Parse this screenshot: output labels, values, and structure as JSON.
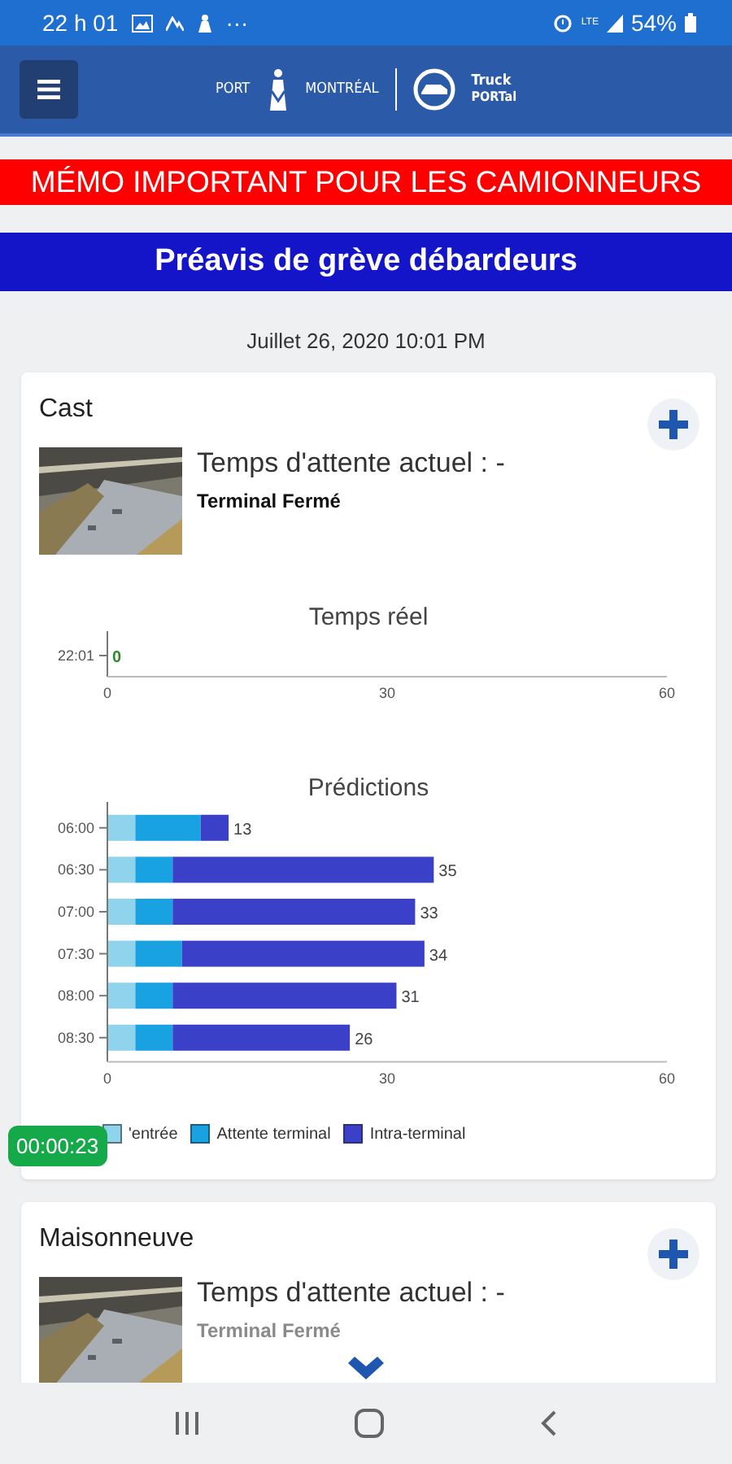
{
  "status_bar": {
    "time": "22 h 01",
    "notification_more": "···",
    "network": "LTE",
    "battery": "54%"
  },
  "header": {
    "logo_left": "PORT",
    "logo_right": "MONTRÉAL",
    "app_name_1": "Truck",
    "app_name_2": "PORTal"
  },
  "memo_banner": "MÉMO IMPORTANT POUR LES CAMIONNEURS",
  "notice_banner": "Préavis de grève débardeurs",
  "date": "Juillet 26, 2020 10:01 PM",
  "terminals": [
    {
      "name": "Cast",
      "wait_label": "Temps d'attente actuel : -",
      "status": "Terminal Fermé",
      "realtime_title": "Temps réel",
      "realtime_chart": {
        "chart_data": {
          "type": "bar",
          "orientation": "horizontal",
          "categories": [
            "22:01"
          ],
          "series": [
            {
              "color": "#2e8b2e",
              "values": [
                0
              ]
            }
          ],
          "xlim": [
            0,
            60
          ],
          "xticks": [
            0,
            30,
            60
          ],
          "value_labels": [
            "0"
          ]
        }
      },
      "predictions_title": "Prédictions",
      "predictions_chart": {
        "chart_data": {
          "type": "bar",
          "orientation": "horizontal",
          "stacked": true,
          "categories": [
            "06:00",
            "06:30",
            "07:00",
            "07:30",
            "08:00",
            "08:30"
          ],
          "series": [
            {
              "name": "'entrée",
              "color": "#8fd3ec",
              "values": [
                3,
                3,
                3,
                3,
                3,
                3
              ]
            },
            {
              "name": "Attente terminal",
              "color": "#18a2e2",
              "values": [
                7,
                4,
                4,
                5,
                4,
                4
              ]
            },
            {
              "name": "Intra-terminal",
              "color": "#3b40c9",
              "values": [
                3,
                28,
                26,
                26,
                24,
                19
              ]
            }
          ],
          "xlim": [
            0,
            60
          ],
          "xticks": [
            0,
            30,
            60
          ],
          "value_labels": [
            "13",
            "35",
            "33",
            "34",
            "31",
            "26"
          ]
        }
      }
    },
    {
      "name": "Maisonneuve",
      "wait_label": "Temps d'attente actuel : -",
      "status": "Terminal Fermé"
    }
  ],
  "timer": "00:00:23"
}
